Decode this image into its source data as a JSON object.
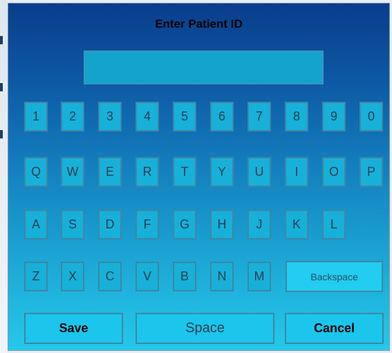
{
  "dialog": {
    "title": "Enter Patient ID",
    "patient_id_value": "",
    "colors": {
      "top": "#0a3d8a",
      "bottom": "#25c8ea",
      "key_fill": "#17b0d9",
      "key_border": "#3f87a3"
    }
  },
  "keyboard": {
    "row1": [
      "1",
      "2",
      "3",
      "4",
      "5",
      "6",
      "7",
      "8",
      "9",
      "0"
    ],
    "row2": [
      "Q",
      "W",
      "E",
      "R",
      "T",
      "Y",
      "U",
      "I",
      "O",
      "P"
    ],
    "row3": [
      "A",
      "S",
      "D",
      "F",
      "G",
      "H",
      "J",
      "K",
      "L"
    ],
    "row4": [
      "Z",
      "X",
      "C",
      "V",
      "B",
      "N",
      "M"
    ],
    "backspace_label": "Backspace"
  },
  "actions": {
    "save_label": "Save",
    "space_label": "Space",
    "cancel_label": "Cancel"
  }
}
